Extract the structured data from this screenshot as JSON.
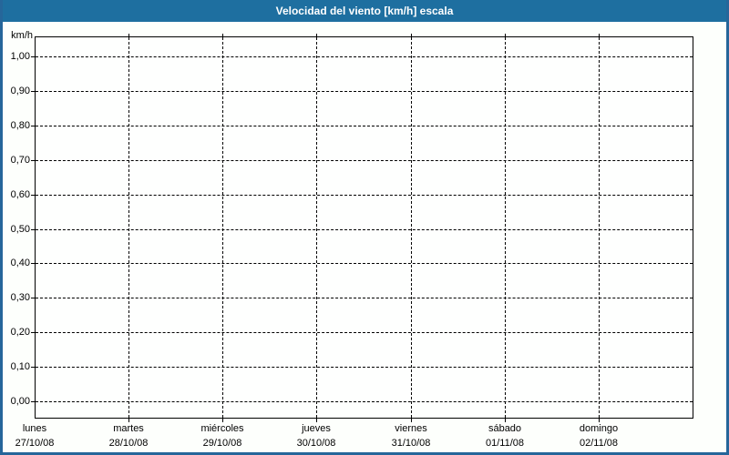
{
  "window": {
    "title": "Velocidad del viento [km/h] escala"
  },
  "colors": {
    "titlebar_bg": "#1E6FA0",
    "titlebar_text": "#FFFFFF",
    "frame_border": "#26669A",
    "window_bg": "#FDFFFC",
    "plot_bg": "#FEFFFE",
    "grid": "#000000",
    "text": "#000000"
  },
  "chart_data": {
    "type": "line",
    "title": "Velocidad del viento [km/h] escala",
    "ylabel": "km/h",
    "ylim": [
      0,
      1
    ],
    "grid": true,
    "legend": false,
    "y_ticks": [
      {
        "value": 1.0,
        "label": "1,00"
      },
      {
        "value": 0.9,
        "label": "0,90"
      },
      {
        "value": 0.8,
        "label": "0,80"
      },
      {
        "value": 0.7,
        "label": "0,70"
      },
      {
        "value": 0.6,
        "label": "0,60"
      },
      {
        "value": 0.5,
        "label": "0,50"
      },
      {
        "value": 0.4,
        "label": "0,40"
      },
      {
        "value": 0.3,
        "label": "0,30"
      },
      {
        "value": 0.2,
        "label": "0,20"
      },
      {
        "value": 0.1,
        "label": "0,10"
      },
      {
        "value": 0.0,
        "label": "0,00"
      }
    ],
    "categories": [
      {
        "day": "lunes",
        "date": "27/10/08"
      },
      {
        "day": "martes",
        "date": "28/10/08"
      },
      {
        "day": "miércoles",
        "date": "29/10/08"
      },
      {
        "day": "jueves",
        "date": "30/10/08"
      },
      {
        "day": "viernes",
        "date": "31/10/08"
      },
      {
        "day": "sábado",
        "date": "01/11/08"
      },
      {
        "day": "domingo",
        "date": "02/11/08"
      }
    ],
    "series": []
  }
}
